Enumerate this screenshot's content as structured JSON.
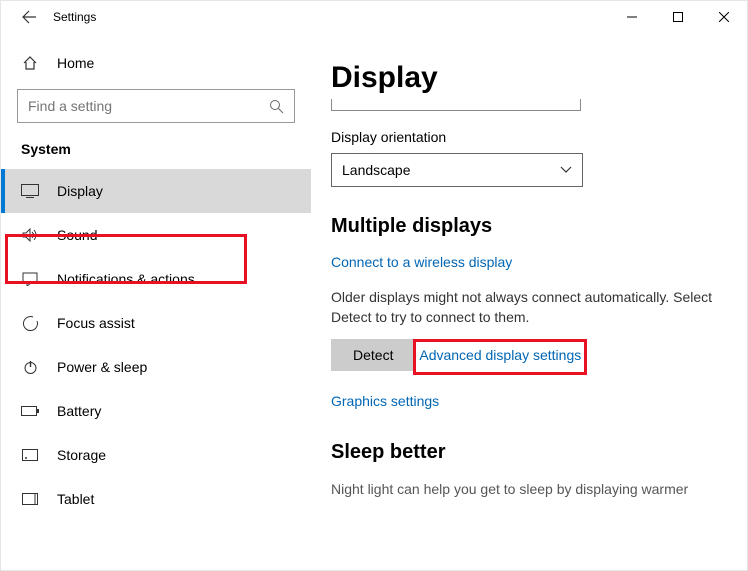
{
  "titlebar": {
    "title": "Settings"
  },
  "sidebar": {
    "home": "Home",
    "search_placeholder": "Find a setting",
    "section": "System",
    "items": [
      {
        "label": "Display"
      },
      {
        "label": "Sound"
      },
      {
        "label": "Notifications & actions"
      },
      {
        "label": "Focus assist"
      },
      {
        "label": "Power & sleep"
      },
      {
        "label": "Battery"
      },
      {
        "label": "Storage"
      },
      {
        "label": "Tablet"
      }
    ]
  },
  "main": {
    "title": "Display",
    "orientation_label": "Display orientation",
    "orientation_value": "Landscape",
    "multiple_heading": "Multiple displays",
    "wireless_link": "Connect to a wireless display",
    "detect_text": "Older displays might not always connect automatically. Select Detect to try to connect to them.",
    "detect_button": "Detect",
    "advanced_link": "Advanced display settings",
    "graphics_link": "Graphics settings",
    "sleep_heading": "Sleep better",
    "sleep_text": "Night light can help you get to sleep by displaying warmer"
  }
}
